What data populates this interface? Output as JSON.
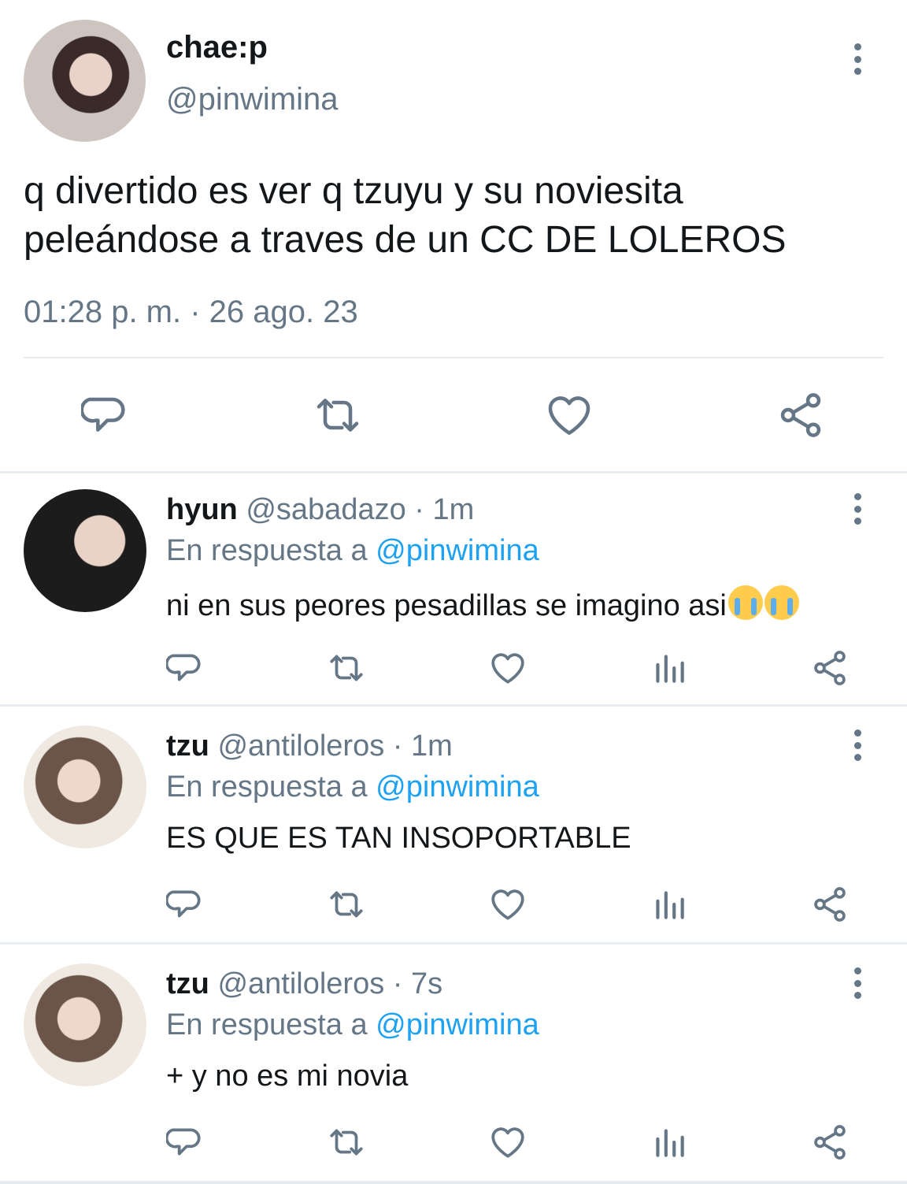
{
  "main": {
    "name": "chae:p",
    "handle": "@pinwimina",
    "text_line1": "q divertido es ver q tzuyu y su noviesita",
    "text_line2": "peleándose a traves de un CC DE LOLEROS",
    "timestamp": "01:28 p. m. · 26 ago. 23"
  },
  "replies": [
    {
      "name": "hyun",
      "handle": "@sabadazo",
      "time": "· 1m",
      "reply_prefix": "En respuesta a",
      "reply_mention": "@pinwimina",
      "text": "ni en sus peores pesadillas se imagino asi"
    },
    {
      "name": "tzu",
      "handle": "@antiloleros",
      "time": "· 1m",
      "reply_prefix": "En respuesta a",
      "reply_mention": "@pinwimina",
      "text": "ES QUE ES TAN INSOPORTABLE"
    },
    {
      "name": "tzu",
      "handle": "@antiloleros",
      "time": "· 7s",
      "reply_prefix": "En respuesta a",
      "reply_mention": "@pinwimina",
      "text": "+ y no es mi novia"
    }
  ],
  "colors": {
    "text": "#14171a",
    "secondary": "#657786",
    "link": "#1da1f2",
    "divider": "#e6ecf0"
  }
}
